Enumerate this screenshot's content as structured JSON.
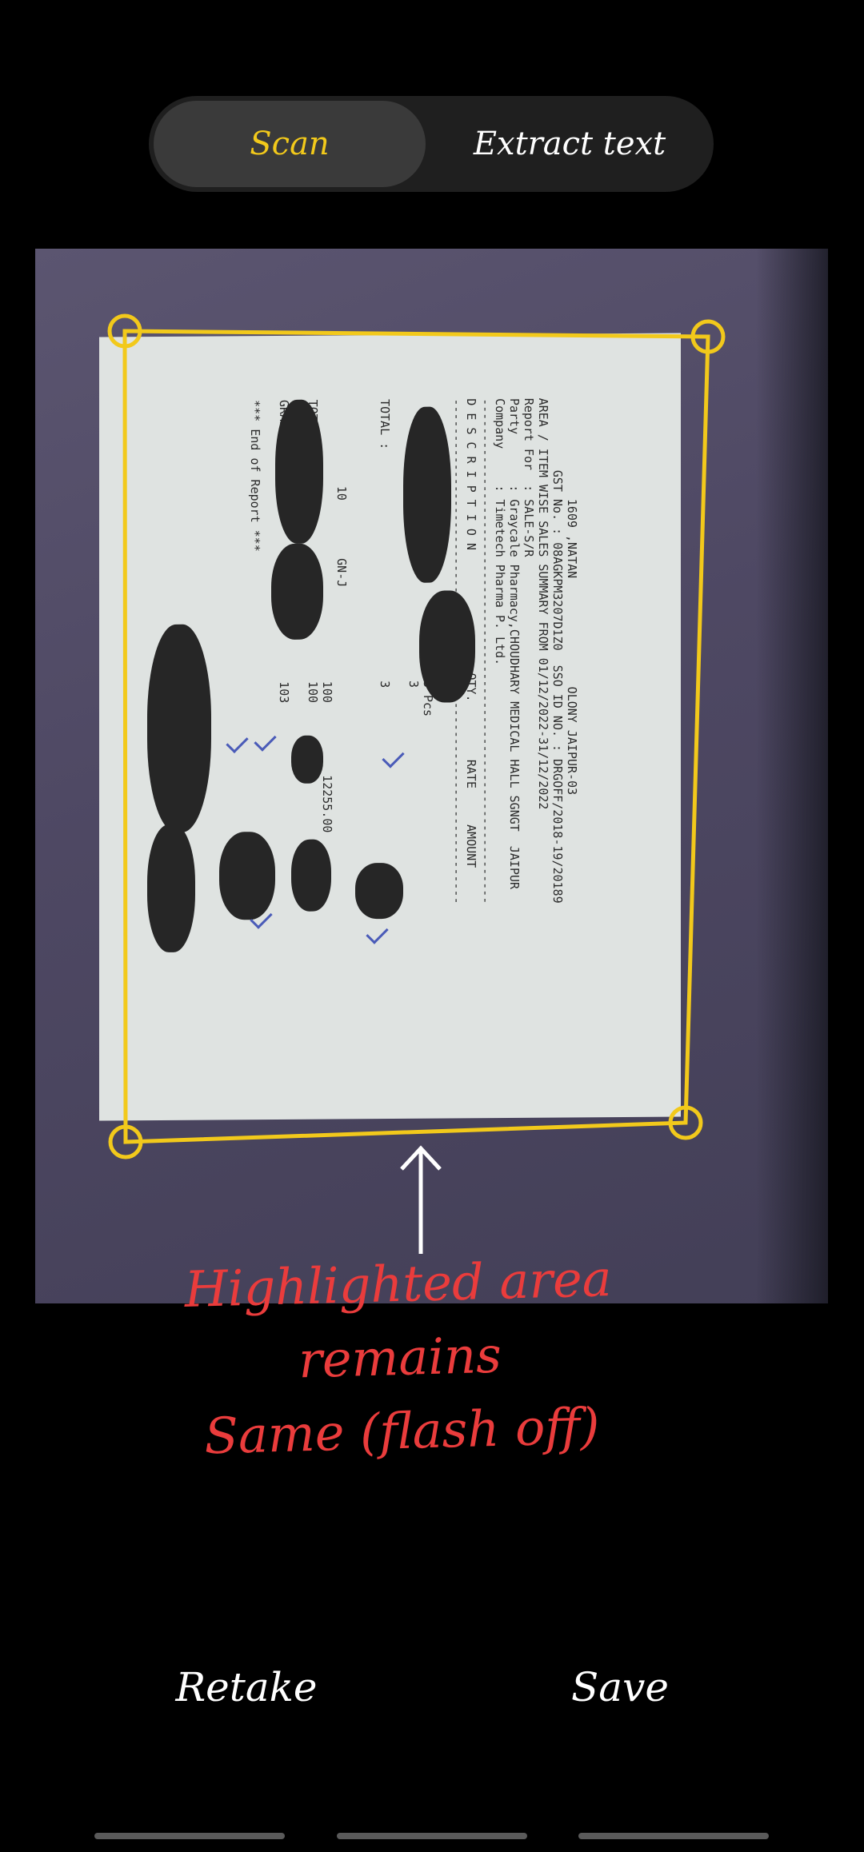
{
  "mode_switch": {
    "tabs": [
      {
        "label": "Scan",
        "selected": true
      },
      {
        "label": "Extract text",
        "selected": false
      }
    ],
    "selected_color": "#f2c91b"
  },
  "document": {
    "lines": [
      "              1609 ,NATAN               OLONY JAIPUR-03",
      "          GST No. : 08AGKPM3207D1Z0  SSO ID NO. : DRGOFF/2018-19/20189",
      "AREA / ITEM WISE SALES SUMMARY FROM 01/12/2022-31/12/2022",
      "Report For  : SALE-S/R",
      "Party       : Graycale Pharmacy,CHOUDHARY MEDICAL HALL SGNGT  JAIPUR",
      "Company     : Timetech Pharma P. Ltd.",
      "----------------------------------------------------------------------",
      "D E S C R I P T I O N                 QTY.        RATE     AMOUNT",
      "----------------------------------------------------------------------",
      "",
      "        10                             3 Pcs",
      "                                       3",
      "",
      "TOTAL :                                3",
      "",
      "",
      "            10        GN-J",
      "                                       100          12255.00",
      "TOTAL :                                100",
      "",
      "GRAND TOTAL :                          103",
      "",
      "*** End of Report ***"
    ]
  },
  "annotation": {
    "lines": [
      "Highlighted area remains",
      "Same (flash off)"
    ],
    "color": "#ea3c3c"
  },
  "actions": {
    "retake_label": "Retake",
    "save_label": "Save"
  },
  "crop": {
    "stroke_color": "#f2c91b"
  }
}
